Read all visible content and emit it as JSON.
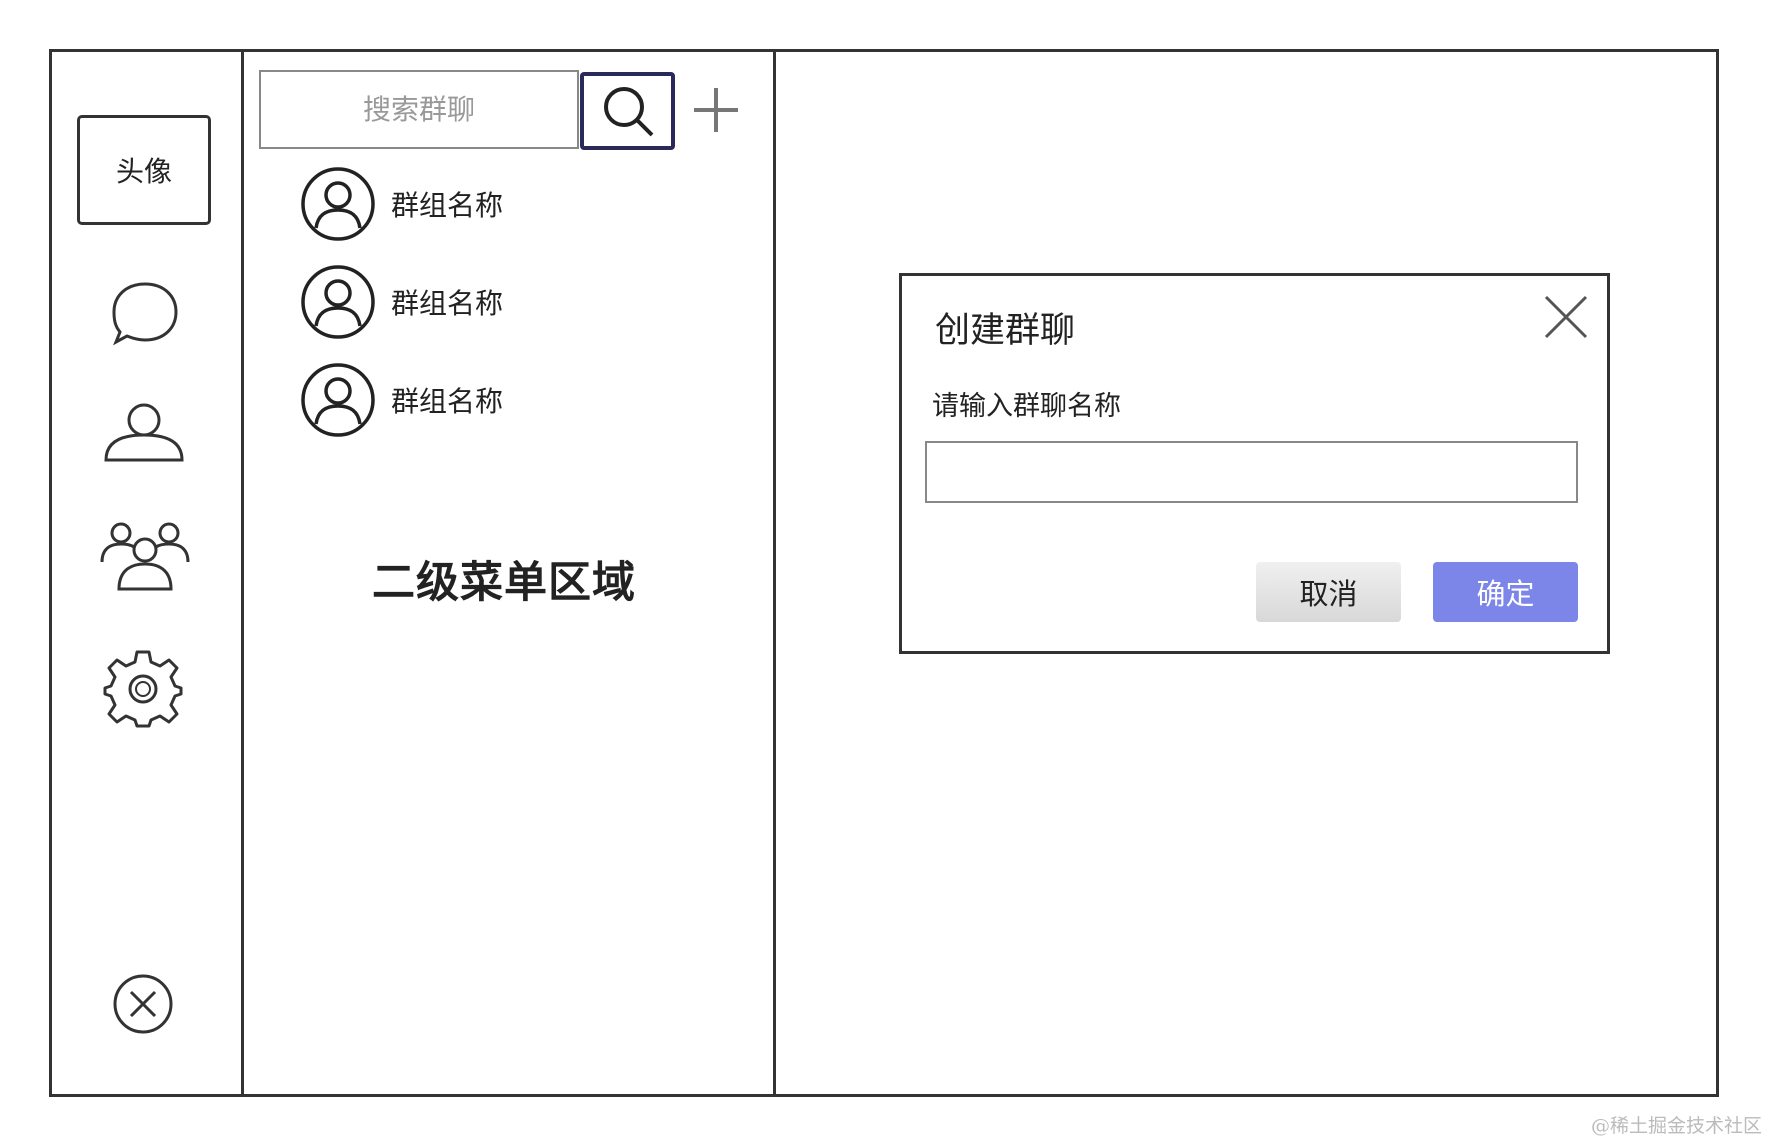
{
  "sidebar": {
    "avatar_label": "头像",
    "icons": [
      "chat-bubble-icon",
      "user-icon",
      "group-icon",
      "gear-icon",
      "close-circle-icon"
    ]
  },
  "secondary_menu": {
    "search_placeholder": "搜索群聊",
    "groups": [
      {
        "name": "群组名称"
      },
      {
        "name": "群组名称"
      },
      {
        "name": "群组名称"
      }
    ],
    "area_title": "二级菜单区域"
  },
  "dialog": {
    "title": "创建群聊",
    "field_label": "请输入群聊名称",
    "field_value": "",
    "cancel_label": "取消",
    "confirm_label": "确定"
  },
  "colors": {
    "confirm_button": "#7c85e8",
    "border": "#333333",
    "search_button_border": "#2a2a5a"
  },
  "watermark": "@稀土掘金技术社区"
}
